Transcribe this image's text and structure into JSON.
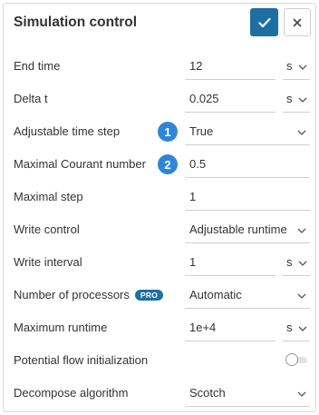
{
  "panel": {
    "title": "Simulation control",
    "confirm_icon": "checkmark-icon",
    "close_icon": "close-icon",
    "accent_color": "#1f6fa3",
    "badge_color": "#2f86d6"
  },
  "fields": {
    "end_time": {
      "label": "End time",
      "value": "12",
      "unit": "s"
    },
    "delta_t": {
      "label": "Delta t",
      "value": "0.025",
      "unit": "s"
    },
    "adjustable_time_step": {
      "label": "Adjustable time step",
      "value": "True",
      "badge": "1"
    },
    "max_courant": {
      "label": "Maximal Courant number",
      "value": "0.5",
      "badge": "2"
    },
    "max_step": {
      "label": "Maximal step",
      "value": "1"
    },
    "write_control": {
      "label": "Write control",
      "value": "Adjustable runtime"
    },
    "write_interval": {
      "label": "Write interval",
      "value": "1",
      "unit": "s"
    },
    "num_processors": {
      "label": "Number of processors",
      "badge": "PRO",
      "value": "Automatic"
    },
    "max_runtime": {
      "label": "Maximum runtime",
      "value": "1e+4",
      "unit": "s"
    },
    "potential_flow": {
      "label": "Potential flow initialization",
      "enabled": false
    },
    "decompose": {
      "label": "Decompose algorithm",
      "value": "Scotch"
    }
  }
}
